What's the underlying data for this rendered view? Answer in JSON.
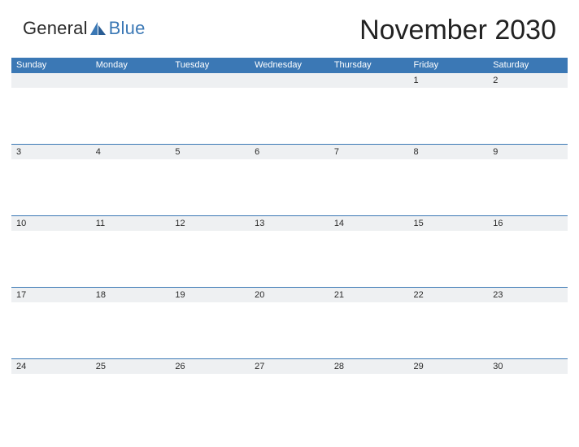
{
  "logo": {
    "name": "General",
    "accent": "Blue"
  },
  "title": "November 2030",
  "colors": {
    "primary": "#3b78b5",
    "dayBg": "#eef0f2"
  },
  "weekdays": [
    "Sunday",
    "Monday",
    "Tuesday",
    "Wednesday",
    "Thursday",
    "Friday",
    "Saturday"
  ],
  "weeks": [
    [
      "",
      "",
      "",
      "",
      "",
      "1",
      "2"
    ],
    [
      "3",
      "4",
      "5",
      "6",
      "7",
      "8",
      "9"
    ],
    [
      "10",
      "11",
      "12",
      "13",
      "14",
      "15",
      "16"
    ],
    [
      "17",
      "18",
      "19",
      "20",
      "21",
      "22",
      "23"
    ],
    [
      "24",
      "25",
      "26",
      "27",
      "28",
      "29",
      "30"
    ]
  ]
}
